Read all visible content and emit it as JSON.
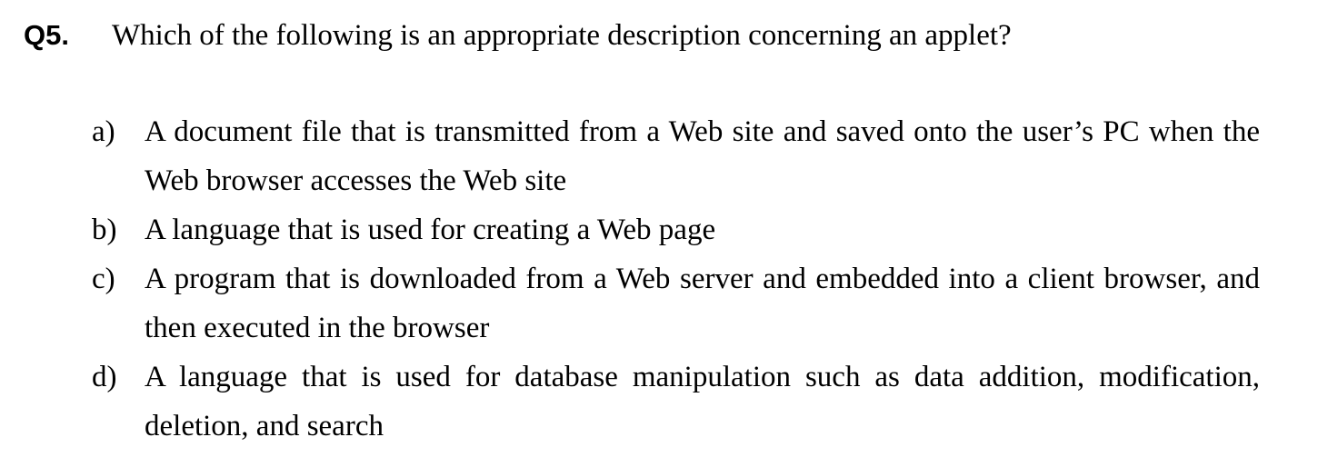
{
  "question": {
    "number": "Q5.",
    "text": "Which of the following is an appropriate description concerning an applet?"
  },
  "options": [
    {
      "label": "a)",
      "text": "A document file that is transmitted from a Web site and saved onto the user’s PC when the Web browser accesses the Web site"
    },
    {
      "label": "b)",
      "text": "A language that is used for creating a Web page"
    },
    {
      "label": "c)",
      "text": "A program that is downloaded from a Web server and embedded into a client browser, and then executed in the browser"
    },
    {
      "label": "d)",
      "text": "A language that is used for database manipulation such as data addition, modification, deletion, and search"
    }
  ]
}
